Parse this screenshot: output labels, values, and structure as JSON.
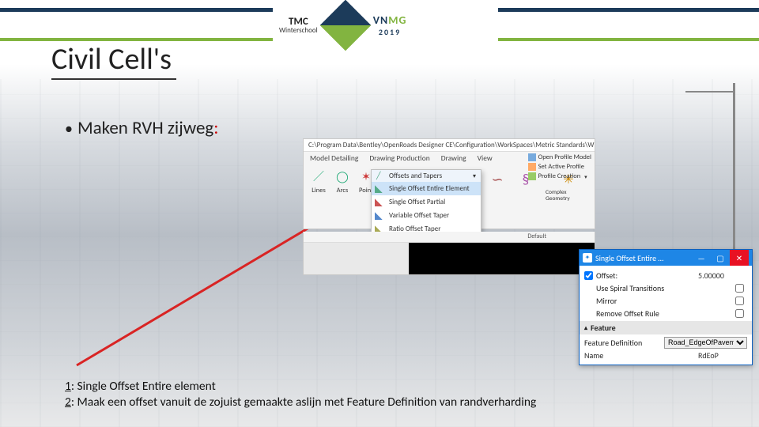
{
  "header": {
    "tmc_label": "TMC",
    "tmc_sub": "Winterschool",
    "vnmg_vn": "VN",
    "vnmg_mg": "MG",
    "vnmg_year": "2019"
  },
  "title": "Civil Cell's",
  "bullet": {
    "text": "Maken RVH zijweg",
    "colon": ":"
  },
  "ribbon": {
    "path": "C:\\Program Data\\Bentley\\OpenRoads Designer CE\\Configuration\\WorkSpaces\\Metric Standards\\W",
    "tabs": [
      "Model Detailing",
      "Drawing Production",
      "Drawing",
      "View"
    ],
    "tools": {
      "lines": "Lines",
      "arcs": "Arcs",
      "point": "Point",
      "offsets_tapers": "Offsets and Tapers",
      "reverse": "Reverse Curves",
      "spirals": "Spirals",
      "complex": "Complex Geometry"
    },
    "dropdown": {
      "head": "Offsets and Tapers",
      "items": [
        "Single Offset Entire Element",
        "Single Offset Partial",
        "Variable Offset Taper",
        "Ratio Offset Taper"
      ]
    },
    "right_tools": [
      "Open Profile Model",
      "Set Active Profile",
      "Profile Creation"
    ],
    "default_label": "Default"
  },
  "dialog": {
    "title": "Single Offset Entire …",
    "rows": {
      "offset_label": "Offset:",
      "offset_value": "5.00000",
      "spiral_label": "Use Spiral Transitions",
      "mirror_label": "Mirror",
      "remove_label": "Remove Offset Rule"
    },
    "section": "Feature",
    "feature_def_label": "Feature Definition",
    "feature_def_value": "Road_EdgeOfPavement",
    "name_label": "Name",
    "name_value": "RdEoP"
  },
  "instructions": {
    "line1_u": "1",
    "line1_rest": ": Single Offset Entire element",
    "line2_u": "2",
    "line2_rest": ": Maak een offset vanuit de zojuist gemaakte aslijn met Feature Definition van randverharding"
  }
}
